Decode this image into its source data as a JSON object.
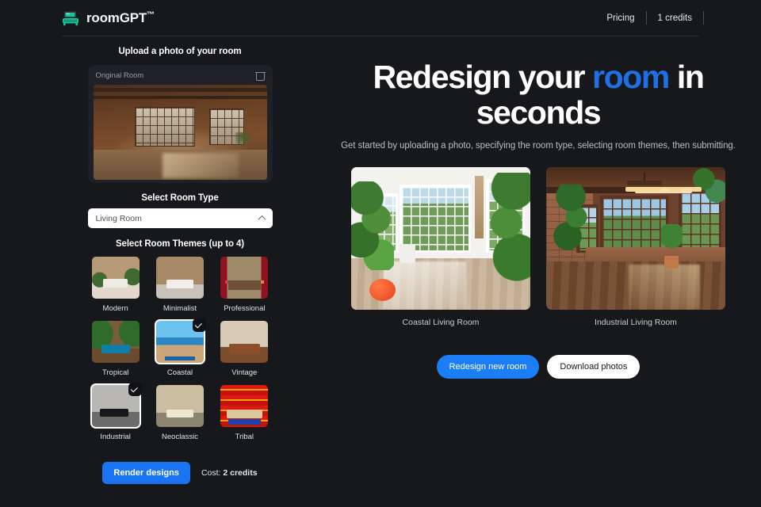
{
  "header": {
    "brand_icon": "couch-icon",
    "brand_name": "roomGPT",
    "brand_tm": "™",
    "pricing_label": "Pricing",
    "credits_label": "1 credits"
  },
  "sidebar": {
    "upload_title": "Upload a photo of your room",
    "original_label": "Original Room",
    "delete_icon": "trash-icon",
    "room_type_title": "Select Room Type",
    "room_type_value": "Living Room",
    "room_type_chevron": "chevron-up-icon",
    "themes_title": "Select Room Themes (up to 4)",
    "themes": [
      {
        "label": "Modern",
        "art": "t-modern",
        "selected": false
      },
      {
        "label": "Minimalist",
        "art": "t-minimal",
        "selected": false
      },
      {
        "label": "Professional",
        "art": "t-prof",
        "selected": false
      },
      {
        "label": "Tropical",
        "art": "t-tropical",
        "selected": false
      },
      {
        "label": "Coastal",
        "art": "t-coastal",
        "selected": true
      },
      {
        "label": "Vintage",
        "art": "t-vintage",
        "selected": false
      },
      {
        "label": "Industrial",
        "art": "t-industrial",
        "selected": true
      },
      {
        "label": "Neoclassic",
        "art": "t-neo",
        "selected": false
      },
      {
        "label": "Tribal",
        "art": "t-tribal",
        "selected": false
      }
    ],
    "render_button": "Render designs",
    "cost_prefix": "Cost:",
    "cost_value": "2 credits"
  },
  "main": {
    "heading_part1": "Redesign your ",
    "heading_accent": "room",
    "heading_part2": " in seconds",
    "subheading": "Get started by uploading a photo, specifying the room type, selecting room themes, then submitting.",
    "results": [
      {
        "caption": "Coastal Living Room"
      },
      {
        "caption": "Industrial Living Room"
      }
    ],
    "redesign_button": "Redesign new room",
    "download_button": "Download photos"
  },
  "colors": {
    "background": "#17181c",
    "card": "#1f2127",
    "accent_blue": "#1f6fe5",
    "button_blue": "#1a73f0",
    "pill_blue": "#1b7ef5",
    "text_primary": "#ffffff",
    "text_muted": "#b9bcc3"
  }
}
